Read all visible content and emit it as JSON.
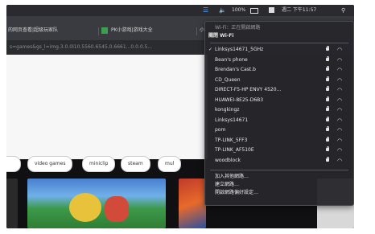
{
  "menubar": {
    "wifi_icon": "wifi-icon",
    "volume_icon": "volume-icon",
    "battery": "100%",
    "clock": "週二 下午11:57",
    "search_icon": "search-icon"
  },
  "browser": {
    "tabs": [
      "的网页查看|超级玩家队",
      "PK小游戏|游戏大全",
      "小游戏"
    ],
    "address": "s=games&gs_l=img.3.0.0l10.5560.6545.0.6661...0.0.0.5..."
  },
  "chips": [
    "video games",
    "miniclip",
    "steam",
    "mul"
  ],
  "wifi_menu": {
    "status": "Wi-Fi：正在開啟網路",
    "toggle": "關閉 Wi-Fi",
    "networks": [
      {
        "name": "Linksys14671_5GHz",
        "selected": true
      },
      {
        "name": "Bean's phone",
        "selected": false
      },
      {
        "name": "Brendan's Cast.b",
        "selected": false
      },
      {
        "name": "CD_Queen",
        "selected": false
      },
      {
        "name": "DIRECT-F5-HP ENVY 4520...",
        "selected": false
      },
      {
        "name": "HUAWEI-8E25-D6B3",
        "selected": false
      },
      {
        "name": "kongkingz",
        "selected": false
      },
      {
        "name": "Linksys14671",
        "selected": false
      },
      {
        "name": "pom",
        "selected": false
      },
      {
        "name": "TP-LINK_5FF3",
        "selected": false
      },
      {
        "name": "TP-LINK_AF510E",
        "selected": false
      },
      {
        "name": "woodblock",
        "selected": false
      }
    ],
    "actions": [
      "加入其他網路…",
      "建立網路…",
      "開啟網路偏好設定…"
    ]
  }
}
